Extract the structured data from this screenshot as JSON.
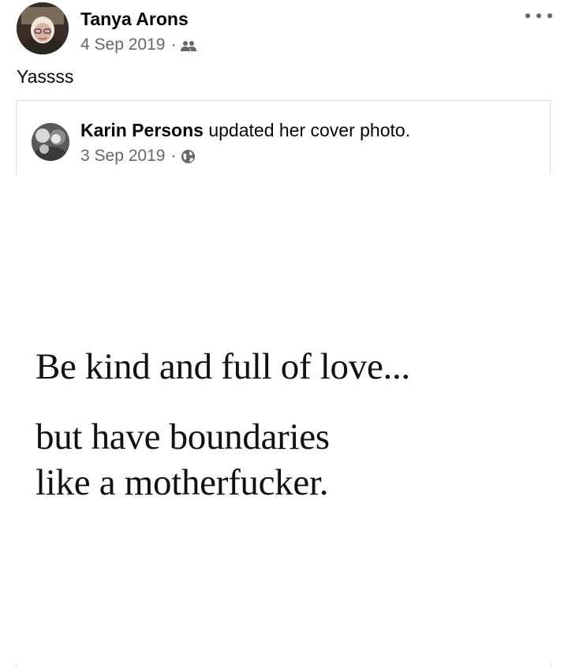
{
  "post": {
    "author": "Tanya Arons",
    "date": "4 Sep 2019",
    "separator": "·",
    "audience_icon": "friends-icon",
    "text": "Yassss",
    "more_icon": "more-options-icon"
  },
  "shared_post": {
    "author": "Karin Persons",
    "action": "updated her cover photo.",
    "date": "3 Sep 2019",
    "separator": "·",
    "audience_icon": "globe-icon"
  },
  "cover_photo": {
    "quote_lines": [
      "Be kind and full of love...",
      "but have boundaries",
      "like a motherfucker."
    ]
  },
  "colors": {
    "text_primary": "#050505",
    "text_secondary": "#65676b",
    "card_border": "#d8dadf"
  }
}
